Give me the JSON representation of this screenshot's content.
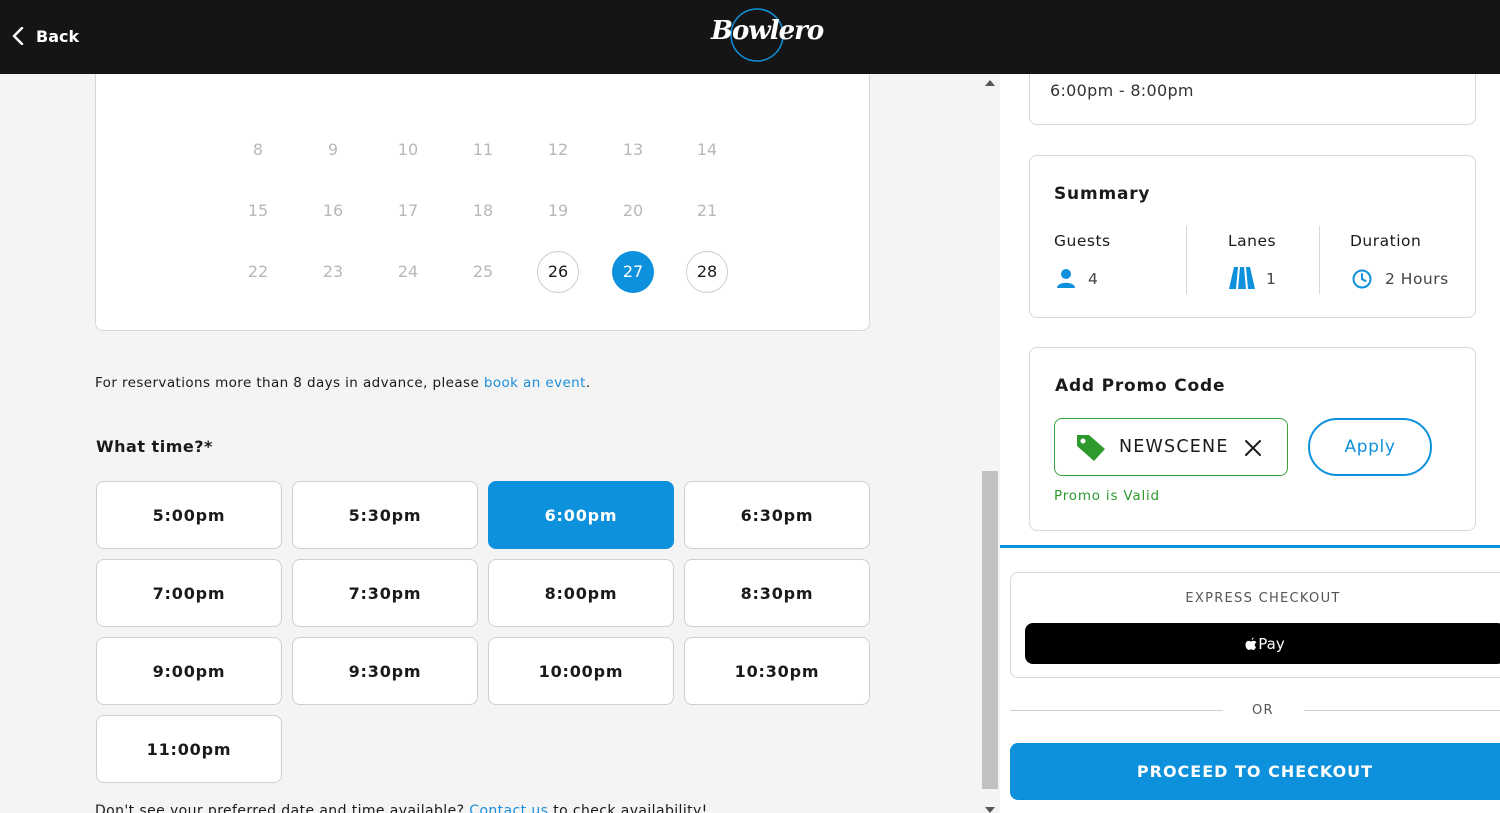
{
  "header": {
    "back_label": "Back",
    "logo_text": "Bowlero"
  },
  "calendar": {
    "rows": [
      [
        {
          "day": "8",
          "state": "disabled"
        },
        {
          "day": "9",
          "state": "disabled"
        },
        {
          "day": "10",
          "state": "disabled"
        },
        {
          "day": "11",
          "state": "disabled"
        },
        {
          "day": "12",
          "state": "disabled"
        },
        {
          "day": "13",
          "state": "disabled"
        },
        {
          "day": "14",
          "state": "disabled"
        }
      ],
      [
        {
          "day": "15",
          "state": "disabled"
        },
        {
          "day": "16",
          "state": "disabled"
        },
        {
          "day": "17",
          "state": "disabled"
        },
        {
          "day": "18",
          "state": "disabled"
        },
        {
          "day": "19",
          "state": "disabled"
        },
        {
          "day": "20",
          "state": "disabled"
        },
        {
          "day": "21",
          "state": "disabled"
        }
      ],
      [
        {
          "day": "22",
          "state": "disabled"
        },
        {
          "day": "23",
          "state": "disabled"
        },
        {
          "day": "24",
          "state": "disabled"
        },
        {
          "day": "25",
          "state": "disabled"
        },
        {
          "day": "26",
          "state": "available"
        },
        {
          "day": "27",
          "state": "selected"
        },
        {
          "day": "28",
          "state": "available"
        }
      ]
    ]
  },
  "advance_note": {
    "text": "For reservations more than 8 days in advance, please ",
    "link": "book an event",
    "suffix": "."
  },
  "time_section": {
    "label": "What time?*",
    "slots": [
      {
        "label": "5:00pm",
        "selected": false
      },
      {
        "label": "5:30pm",
        "selected": false
      },
      {
        "label": "6:00pm",
        "selected": true
      },
      {
        "label": "6:30pm",
        "selected": false
      },
      {
        "label": "7:00pm",
        "selected": false
      },
      {
        "label": "7:30pm",
        "selected": false
      },
      {
        "label": "8:00pm",
        "selected": false
      },
      {
        "label": "8:30pm",
        "selected": false
      },
      {
        "label": "9:00pm",
        "selected": false
      },
      {
        "label": "9:30pm",
        "selected": false
      },
      {
        "label": "10:00pm",
        "selected": false
      },
      {
        "label": "10:30pm",
        "selected": false
      },
      {
        "label": "11:00pm",
        "selected": false
      }
    ]
  },
  "bottom_note": {
    "text": "Don't see your preferred date and time available? ",
    "link": "Contact us",
    "suffix": " to check availability!"
  },
  "booking_time": "6:00pm - 8:00pm",
  "summary": {
    "title": "Summary",
    "guests_label": "Guests",
    "guests_value": "4",
    "lanes_label": "Lanes",
    "lanes_value": "1",
    "duration_label": "Duration",
    "duration_value": "2 Hours"
  },
  "promo": {
    "title": "Add Promo Code",
    "code": "NEWSCENE",
    "apply_label": "Apply",
    "status": "Promo is Valid"
  },
  "checkout": {
    "express_label": "EXPRESS CHECKOUT",
    "applepay_label": "Pay",
    "or_label": "OR",
    "proceed_label": "PROCEED TO CHECKOUT"
  },
  "colors": {
    "accent": "#0e91dd",
    "valid_green": "#2e9a2e",
    "header_bg": "#151515"
  }
}
